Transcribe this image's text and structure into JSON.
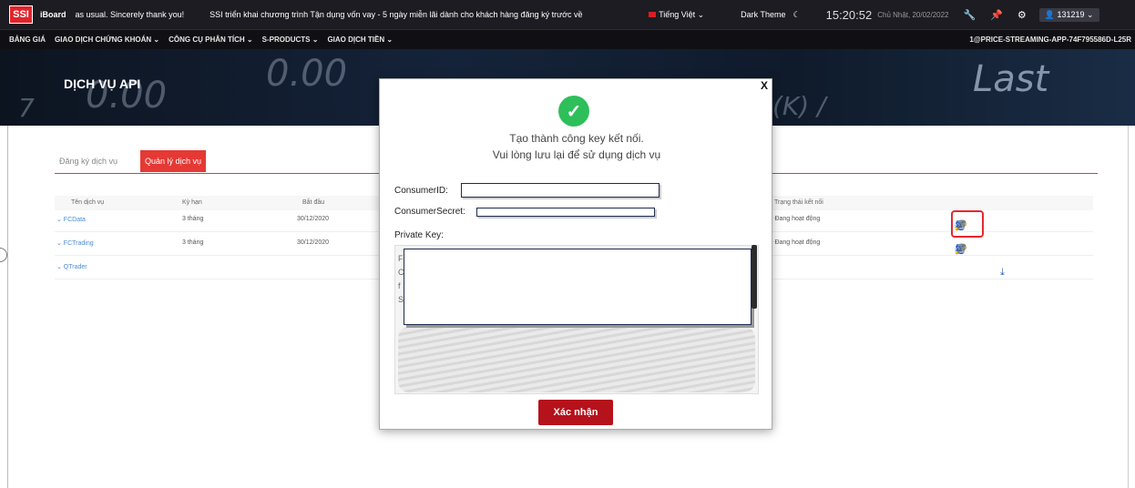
{
  "topbar": {
    "logo": "SSI",
    "brand": "iBoard",
    "ticker_left": "as usual. Sincerely thank you!",
    "ticker_main": "SSI triển khai chương trình Tận dụng vốn vay - 5 ngày miễn lãi dành cho khách hàng đăng ký trước về",
    "language": "Tiếng Việt ⌄",
    "theme_label": "Dark Theme",
    "moon_icon": "☾",
    "time": "15:20:52",
    "date": "Chủ Nhật, 20/02/2022",
    "account": "131219 ⌄"
  },
  "nav": {
    "items": [
      "BẢNG GIÁ",
      "GIAO DỊCH CHỨNG KHOÁN ⌄",
      "CÔNG CỤ PHÂN TÍCH ⌄",
      "S-PRODUCTS ⌄",
      "GIAO DỊCH TIỀN ⌄"
    ],
    "right": "1@PRICE-STREAMING-APP-74F795586D-L25R"
  },
  "banner": {
    "title": "DỊCH VỤ API",
    "bg_1": "0.00",
    "bg_2": "0.00",
    "bg_3": "Last",
    "bg_4": "(K) /",
    "bg_5": "7"
  },
  "tabs": {
    "register": "Đăng ký dịch vụ",
    "manage": "Quản lý dịch vụ"
  },
  "table": {
    "headers": [
      "Tên dịch vụ",
      "Kỳ hạn",
      "Bắt đầu",
      "Trạng thái kết nối"
    ],
    "rows": [
      {
        "name": "⌄ FCData",
        "term": "3 tháng",
        "start": "30/12/2020",
        "status": "Đang hoạt động"
      },
      {
        "name": "⌄ FCTrading",
        "term": "3 tháng",
        "start": "30/12/2020",
        "status": "Đang hoạt động"
      },
      {
        "name": "⌄ QTrader",
        "term": "",
        "start": "",
        "status": ""
      }
    ]
  },
  "modal": {
    "close": "X",
    "message_line1": "Tạo thành công key kết nối.",
    "message_line2": "Vui lòng lưu lại để sử dụng dịch vụ",
    "consumer_id_label": "ConsumerID:",
    "consumer_secret_label": "ConsumerSecret:",
    "private_key_label": "Private Key:",
    "pk_partial": [
      "F",
      "C",
      "f",
      "S"
    ],
    "confirm_label": "Xác nhận"
  },
  "colors": {
    "accent": "#e53935",
    "confirm": "#b5121b",
    "success": "#2fbf5a",
    "link": "#2857b8"
  }
}
